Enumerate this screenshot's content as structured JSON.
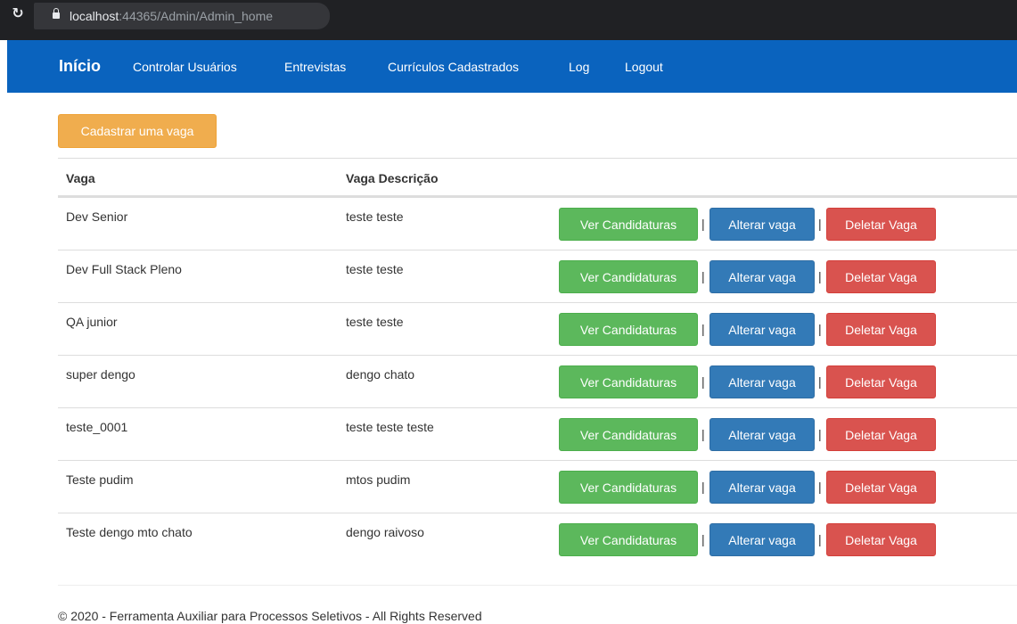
{
  "browser": {
    "url_host": "localhost",
    "url_rest": ":44365/Admin/Admin_home"
  },
  "navbar": {
    "brand": "Início",
    "items": [
      {
        "label": "Controlar Usuários"
      },
      {
        "label": "Entrevistas"
      },
      {
        "label": "Currículos Cadastrados"
      },
      {
        "label": "Log"
      },
      {
        "label": "Logout"
      }
    ]
  },
  "main": {
    "add_button": "Cadastrar uma vaga",
    "table": {
      "headers": [
        "Vaga",
        "Vaga Descrição"
      ],
      "actions": {
        "view": "Ver Candidaturas",
        "edit": "Alterar vaga",
        "delete": "Deletar Vaga",
        "separator": "|"
      },
      "rows": [
        {
          "vaga": "Dev Senior",
          "descricao": "teste teste"
        },
        {
          "vaga": "Dev Full Stack Pleno",
          "descricao": "teste teste"
        },
        {
          "vaga": "QA junior",
          "descricao": "teste teste"
        },
        {
          "vaga": "super dengo",
          "descricao": "dengo chato"
        },
        {
          "vaga": "teste_0001",
          "descricao": "teste teste teste"
        },
        {
          "vaga": "Teste pudim",
          "descricao": "mtos pudim"
        },
        {
          "vaga": "Teste dengo mto chato",
          "descricao": "dengo raivoso"
        }
      ]
    }
  },
  "footer": {
    "text": "© 2020 - Ferramenta Auxiliar para Processos Seletivos - All Rights Reserved"
  },
  "colors": {
    "navbar": "#0a63be",
    "warning": "#f0ad4e",
    "success": "#5cb85c",
    "primary": "#337ab7",
    "danger": "#d9534f"
  }
}
